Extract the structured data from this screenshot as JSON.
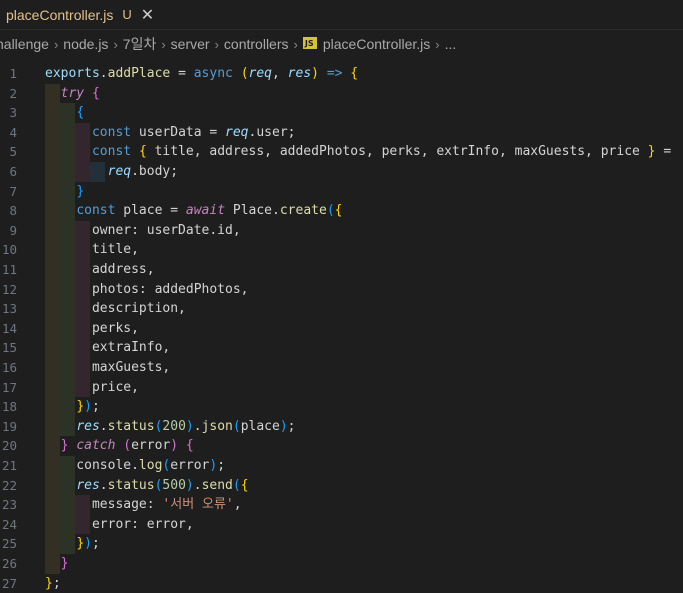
{
  "tab": {
    "filename": "placeController.js",
    "status": "U",
    "close": "✕"
  },
  "breadcrumb": {
    "items": [
      "hallenge",
      "node.js",
      "7일차",
      "server",
      "controllers",
      "placeController.js",
      "..."
    ],
    "file_badge": "JS",
    "separator": "›"
  },
  "editor": {
    "line_numbers": [
      "1",
      "2",
      "3",
      "4",
      "5",
      "6",
      "7",
      "8",
      "9",
      "10",
      "11",
      "12",
      "13",
      "14",
      "15",
      "16",
      "17",
      "18",
      "19",
      "20",
      "21",
      "22",
      "23",
      "24",
      "25",
      "26",
      "27"
    ],
    "lines": [
      [
        {
          "t": "exports",
          "c": "var"
        },
        {
          "t": ".",
          "c": "plain"
        },
        {
          "t": "addPlace",
          "c": "fn"
        },
        {
          "t": " = ",
          "c": "plain"
        },
        {
          "t": "async",
          "c": "kw"
        },
        {
          "t": " ",
          "c": "plain"
        },
        {
          "t": "(",
          "c": "b1"
        },
        {
          "t": "req",
          "c": "prm"
        },
        {
          "t": ", ",
          "c": "plain"
        },
        {
          "t": "res",
          "c": "prm"
        },
        {
          "t": ")",
          "c": "b1"
        },
        {
          "t": " ",
          "c": "plain"
        },
        {
          "t": "=>",
          "c": "kw"
        },
        {
          "t": " ",
          "c": "plain"
        },
        {
          "t": "{",
          "c": "b1"
        }
      ],
      [
        {
          "t": "  ",
          "c": "plain"
        },
        {
          "t": "try",
          "c": "ctl"
        },
        {
          "t": " ",
          "c": "plain"
        },
        {
          "t": "{",
          "c": "b2"
        }
      ],
      [
        {
          "t": "    ",
          "c": "plain"
        },
        {
          "t": "{",
          "c": "b3"
        }
      ],
      [
        {
          "t": "      ",
          "c": "plain"
        },
        {
          "t": "const",
          "c": "kw"
        },
        {
          "t": " userData = ",
          "c": "plain"
        },
        {
          "t": "req",
          "c": "prm"
        },
        {
          "t": ".user;",
          "c": "plain"
        }
      ],
      [
        {
          "t": "      ",
          "c": "plain"
        },
        {
          "t": "const",
          "c": "kw"
        },
        {
          "t": " ",
          "c": "plain"
        },
        {
          "t": "{",
          "c": "b1"
        },
        {
          "t": " title, address, addedPhotos, perks, extrInfo, maxGuests, price ",
          "c": "plain"
        },
        {
          "t": "}",
          "c": "b1"
        },
        {
          "t": " =",
          "c": "plain"
        }
      ],
      [
        {
          "t": "        ",
          "c": "plain"
        },
        {
          "t": "req",
          "c": "prm"
        },
        {
          "t": ".body;",
          "c": "plain"
        }
      ],
      [
        {
          "t": "    ",
          "c": "plain"
        },
        {
          "t": "}",
          "c": "b3"
        }
      ],
      [
        {
          "t": "    ",
          "c": "plain"
        },
        {
          "t": "const",
          "c": "kw"
        },
        {
          "t": " place = ",
          "c": "plain"
        },
        {
          "t": "await",
          "c": "ctl"
        },
        {
          "t": " Place.",
          "c": "plain"
        },
        {
          "t": "create",
          "c": "fn"
        },
        {
          "t": "(",
          "c": "b3"
        },
        {
          "t": "{",
          "c": "b1"
        }
      ],
      [
        {
          "t": "      owner: userDate.id,",
          "c": "plain"
        }
      ],
      [
        {
          "t": "      title,",
          "c": "plain"
        }
      ],
      [
        {
          "t": "      address,",
          "c": "plain"
        }
      ],
      [
        {
          "t": "      photos: addedPhotos,",
          "c": "plain"
        }
      ],
      [
        {
          "t": "      description,",
          "c": "plain"
        }
      ],
      [
        {
          "t": "      perks,",
          "c": "plain"
        }
      ],
      [
        {
          "t": "      extraInfo,",
          "c": "plain"
        }
      ],
      [
        {
          "t": "      maxGuests,",
          "c": "plain"
        }
      ],
      [
        {
          "t": "      price,",
          "c": "plain"
        }
      ],
      [
        {
          "t": "    ",
          "c": "plain"
        },
        {
          "t": "}",
          "c": "b1"
        },
        {
          "t": ")",
          "c": "b3"
        },
        {
          "t": ";",
          "c": "plain"
        }
      ],
      [
        {
          "t": "    ",
          "c": "plain"
        },
        {
          "t": "res",
          "c": "prm"
        },
        {
          "t": ".",
          "c": "plain"
        },
        {
          "t": "status",
          "c": "fn"
        },
        {
          "t": "(",
          "c": "b3"
        },
        {
          "t": "200",
          "c": "num"
        },
        {
          "t": ")",
          "c": "b3"
        },
        {
          "t": ".",
          "c": "plain"
        },
        {
          "t": "json",
          "c": "fn"
        },
        {
          "t": "(",
          "c": "b3"
        },
        {
          "t": "place",
          "c": "plain"
        },
        {
          "t": ")",
          "c": "b3"
        },
        {
          "t": ";",
          "c": "plain"
        }
      ],
      [
        {
          "t": "  ",
          "c": "plain"
        },
        {
          "t": "}",
          "c": "b2"
        },
        {
          "t": " ",
          "c": "plain"
        },
        {
          "t": "catch",
          "c": "ctl"
        },
        {
          "t": " ",
          "c": "plain"
        },
        {
          "t": "(",
          "c": "b2"
        },
        {
          "t": "error",
          "c": "plain"
        },
        {
          "t": ")",
          "c": "b2"
        },
        {
          "t": " ",
          "c": "plain"
        },
        {
          "t": "{",
          "c": "b2"
        }
      ],
      [
        {
          "t": "    console.",
          "c": "plain"
        },
        {
          "t": "log",
          "c": "fn"
        },
        {
          "t": "(",
          "c": "b3"
        },
        {
          "t": "error",
          "c": "plain"
        },
        {
          "t": ")",
          "c": "b3"
        },
        {
          "t": ";",
          "c": "plain"
        }
      ],
      [
        {
          "t": "    ",
          "c": "plain"
        },
        {
          "t": "res",
          "c": "prm"
        },
        {
          "t": ".",
          "c": "plain"
        },
        {
          "t": "status",
          "c": "fn"
        },
        {
          "t": "(",
          "c": "b3"
        },
        {
          "t": "500",
          "c": "num"
        },
        {
          "t": ")",
          "c": "b3"
        },
        {
          "t": ".",
          "c": "plain"
        },
        {
          "t": "send",
          "c": "fn"
        },
        {
          "t": "(",
          "c": "b3"
        },
        {
          "t": "{",
          "c": "b1"
        }
      ],
      [
        {
          "t": "      message: ",
          "c": "plain"
        },
        {
          "t": "'서버 오류'",
          "c": "str"
        },
        {
          "t": ",",
          "c": "plain"
        }
      ],
      [
        {
          "t": "      error: error,",
          "c": "plain"
        }
      ],
      [
        {
          "t": "    ",
          "c": "plain"
        },
        {
          "t": "}",
          "c": "b1"
        },
        {
          "t": ")",
          "c": "b3"
        },
        {
          "t": ";",
          "c": "plain"
        }
      ],
      [
        {
          "t": "  ",
          "c": "plain"
        },
        {
          "t": "}",
          "c": "b2"
        }
      ],
      [
        {
          "t": "}",
          "c": "b1"
        },
        {
          "t": ";",
          "c": "plain"
        }
      ]
    ],
    "indent_levels": [
      0,
      1,
      2,
      3,
      3,
      4,
      2,
      2,
      3,
      3,
      3,
      3,
      3,
      3,
      3,
      3,
      3,
      2,
      2,
      1,
      2,
      2,
      3,
      3,
      2,
      1,
      0
    ]
  }
}
